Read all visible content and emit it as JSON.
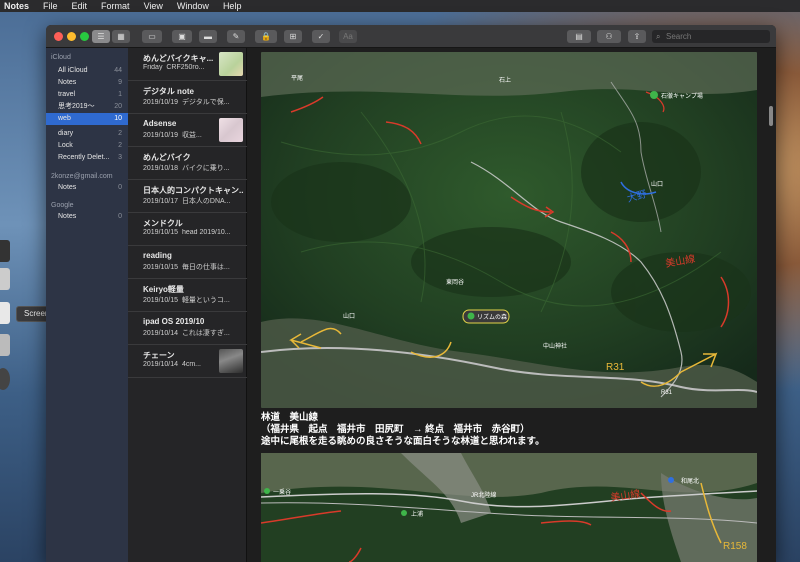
{
  "menubar": {
    "app": "Notes",
    "items": [
      "File",
      "Edit",
      "Format",
      "View",
      "Window",
      "Help"
    ]
  },
  "tooltip": "Screenshot",
  "search": {
    "placeholder": "Search"
  },
  "sidebar": {
    "sections": [
      {
        "title": "iCloud",
        "items": [
          {
            "label": "All iCloud",
            "count": "44"
          },
          {
            "label": "Notes",
            "count": "9"
          },
          {
            "label": "travel",
            "count": "1"
          },
          {
            "label": "思考2019〜",
            "count": "20"
          },
          {
            "label": "web",
            "count": "10",
            "selected": true
          },
          {
            "label": "diary",
            "count": "2"
          },
          {
            "label": "Lock",
            "count": "2"
          },
          {
            "label": "Recently Delet...",
            "count": "3"
          }
        ]
      },
      {
        "title": "2konze@gmail.com",
        "items": [
          {
            "label": "Notes",
            "count": "0"
          }
        ]
      },
      {
        "title": "Google",
        "items": [
          {
            "label": "Notes",
            "count": "0"
          }
        ]
      }
    ]
  },
  "notes": [
    {
      "title": "めんどバイクキャ...",
      "date": "Friday",
      "preview": "CRF250ro..."
    },
    {
      "title": "デジタル note",
      "date": "2019/10/19",
      "preview": "デジタルで保..."
    },
    {
      "title": "Adsense",
      "date": "2019/10/19",
      "preview": "収益..."
    },
    {
      "title": "めんどバイク",
      "date": "2019/10/18",
      "preview": "バイクに乗り..."
    },
    {
      "title": "日本人的コンパクトキャン...",
      "date": "2019/10/17",
      "preview": "日本人のDNA..."
    },
    {
      "title": "メンドクル",
      "date": "2019/10/15",
      "preview": "head 2019/10..."
    },
    {
      "title": "reading",
      "date": "2019/10/15",
      "preview": "毎日の仕事は..."
    },
    {
      "title": "Keiryo軽量",
      "date": "2019/10/15",
      "preview": "軽量というコ..."
    },
    {
      "title": "ipad OS 2019/10",
      "date": "2019/10/14",
      "preview": "これは凄すぎ..."
    },
    {
      "title": "チェーン",
      "date": "2019/10/14",
      "preview": "4cm..."
    }
  ],
  "content": {
    "heading": "林道　美山線",
    "line1": "（福井県　起点　福井市　田尻町　→ 終点　福井市　赤谷町）",
    "line2": "途中に尾根を走る眺めの良さそうな面白そうな林道と思われます。",
    "map1_labels": {
      "camp": "石徹キャンプ場",
      "road_sign": "R31",
      "marker": "リズムの森",
      "place1": "東岡谷",
      "place2": "山口",
      "place3": "中山神社",
      "place4": "石上",
      "place5": "平尾",
      "place6": "山口",
      "hand1": "美山線",
      "hand2": "R31",
      "hand3": "大野"
    },
    "map2_labels": {
      "place1": "和尾北",
      "place2": "JR北陸線",
      "place3": "上浦",
      "place4": "一乗谷",
      "hand1": "美山線",
      "hand2": "R158"
    }
  }
}
